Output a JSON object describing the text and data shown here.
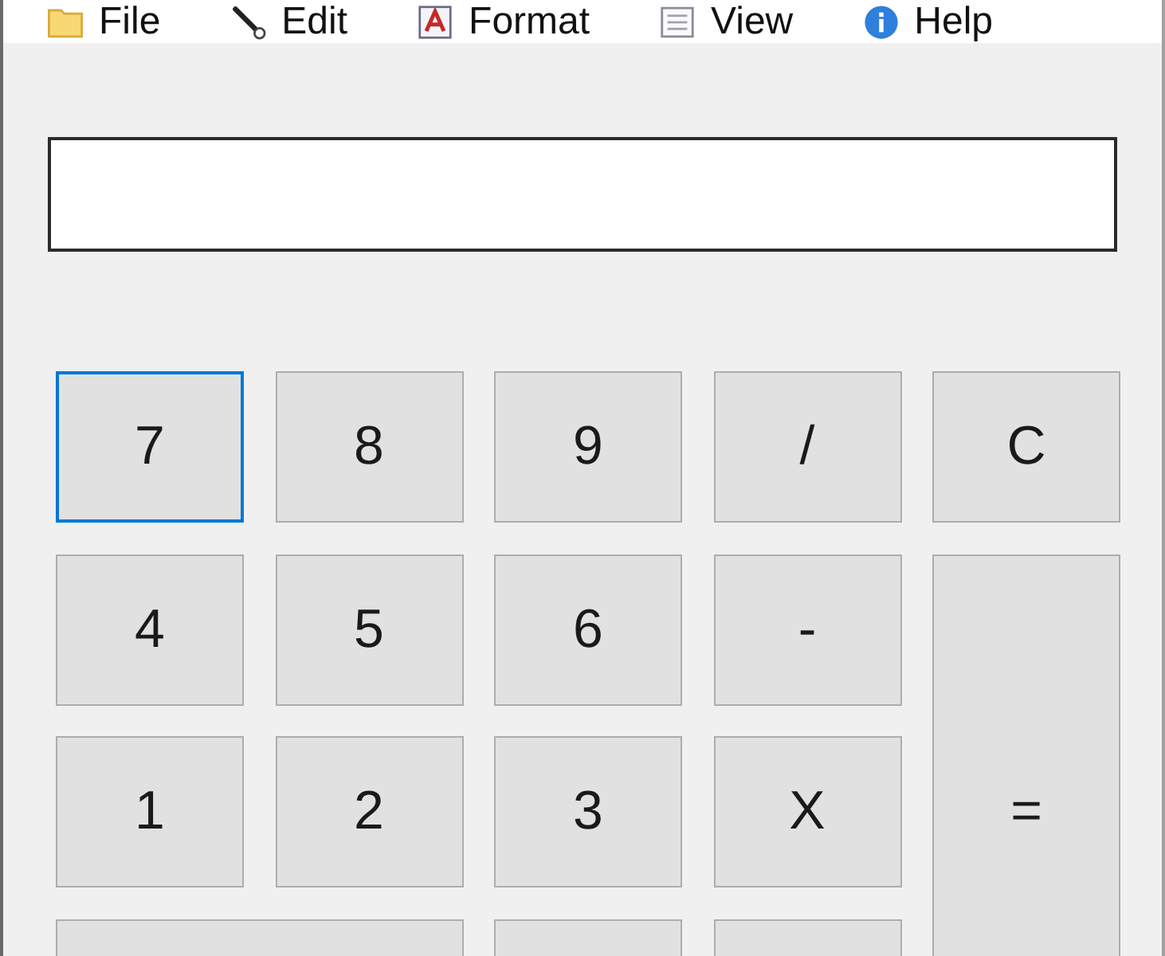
{
  "menu": [
    {
      "label": "File"
    },
    {
      "label": "Edit"
    },
    {
      "label": "Format"
    },
    {
      "label": "View"
    },
    {
      "label": "Help"
    }
  ],
  "keys": [
    {
      "label": "7",
      "focused": true,
      "kind": "normal"
    },
    {
      "label": "8",
      "focused": false,
      "kind": "normal"
    },
    {
      "label": "9",
      "focused": false,
      "kind": "normal"
    },
    {
      "label": "/",
      "focused": false,
      "kind": "normal"
    },
    {
      "label": "C",
      "focused": false,
      "kind": "normal"
    },
    {
      "label": "4",
      "focused": false,
      "kind": "normal"
    },
    {
      "label": "5",
      "focused": false,
      "kind": "normal"
    },
    {
      "label": "6",
      "focused": false,
      "kind": "normal"
    },
    {
      "label": "-",
      "focused": false,
      "kind": "normal"
    },
    {
      "label": "1",
      "focused": false,
      "kind": "normal"
    },
    {
      "label": "2",
      "focused": false,
      "kind": "normal"
    },
    {
      "label": "3",
      "focused": false,
      "kind": "normal"
    },
    {
      "label": "X",
      "focused": false,
      "kind": "normal"
    },
    {
      "label": "=",
      "focused": false,
      "kind": "tall"
    },
    {
      "focused": false,
      "kind": "wide"
    },
    {
      "focused": false,
      "kind": "normal"
    },
    {
      "focused": false,
      "kind": "normal"
    }
  ]
}
